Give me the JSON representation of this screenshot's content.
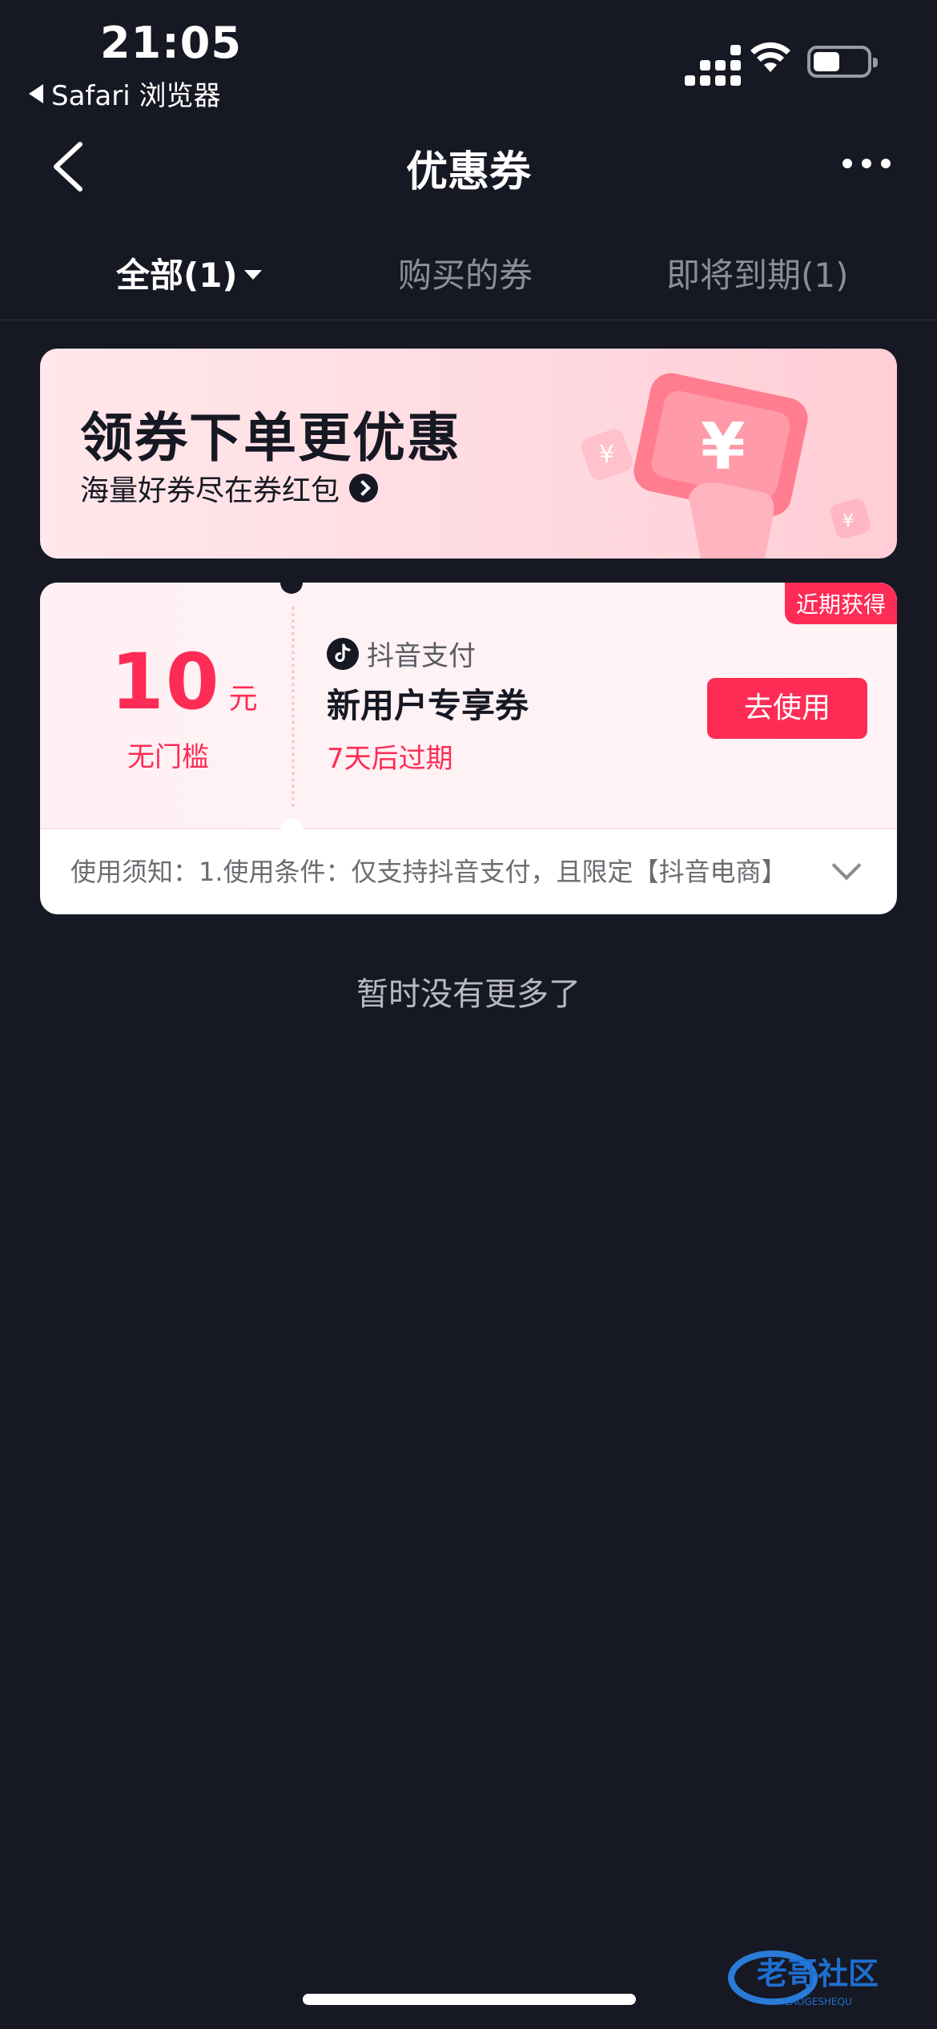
{
  "status_bar": {
    "time": "21:05",
    "back_app": "Safari 浏览器"
  },
  "nav": {
    "title": "优惠券",
    "back_icon": "chevron-left-icon",
    "more_icon": "more-dots-icon"
  },
  "tabs": [
    {
      "label": "全部(1)",
      "active": true
    },
    {
      "label": "购买的券",
      "active": false
    },
    {
      "label": "即将到期(1)",
      "active": false
    }
  ],
  "banner": {
    "title": "领券下单更优惠",
    "subtitle": "海量好券尽在券红包"
  },
  "coupon": {
    "badge": "近期获得",
    "amount": "10",
    "unit": "元",
    "threshold": "无门槛",
    "brand": "抖音支付",
    "name": "新用户专享券",
    "expiry": "7天后过期",
    "button": "去使用",
    "notice": "使用须知：1.使用条件：仅支持抖音支付，且限定【抖音电商】"
  },
  "footer": {
    "end_text": "暂时没有更多了"
  },
  "watermark": {
    "text": "老哥社区",
    "sub": "LAOGESHEQU"
  },
  "colors": {
    "background": "#161823",
    "accent": "#fe2c55"
  }
}
